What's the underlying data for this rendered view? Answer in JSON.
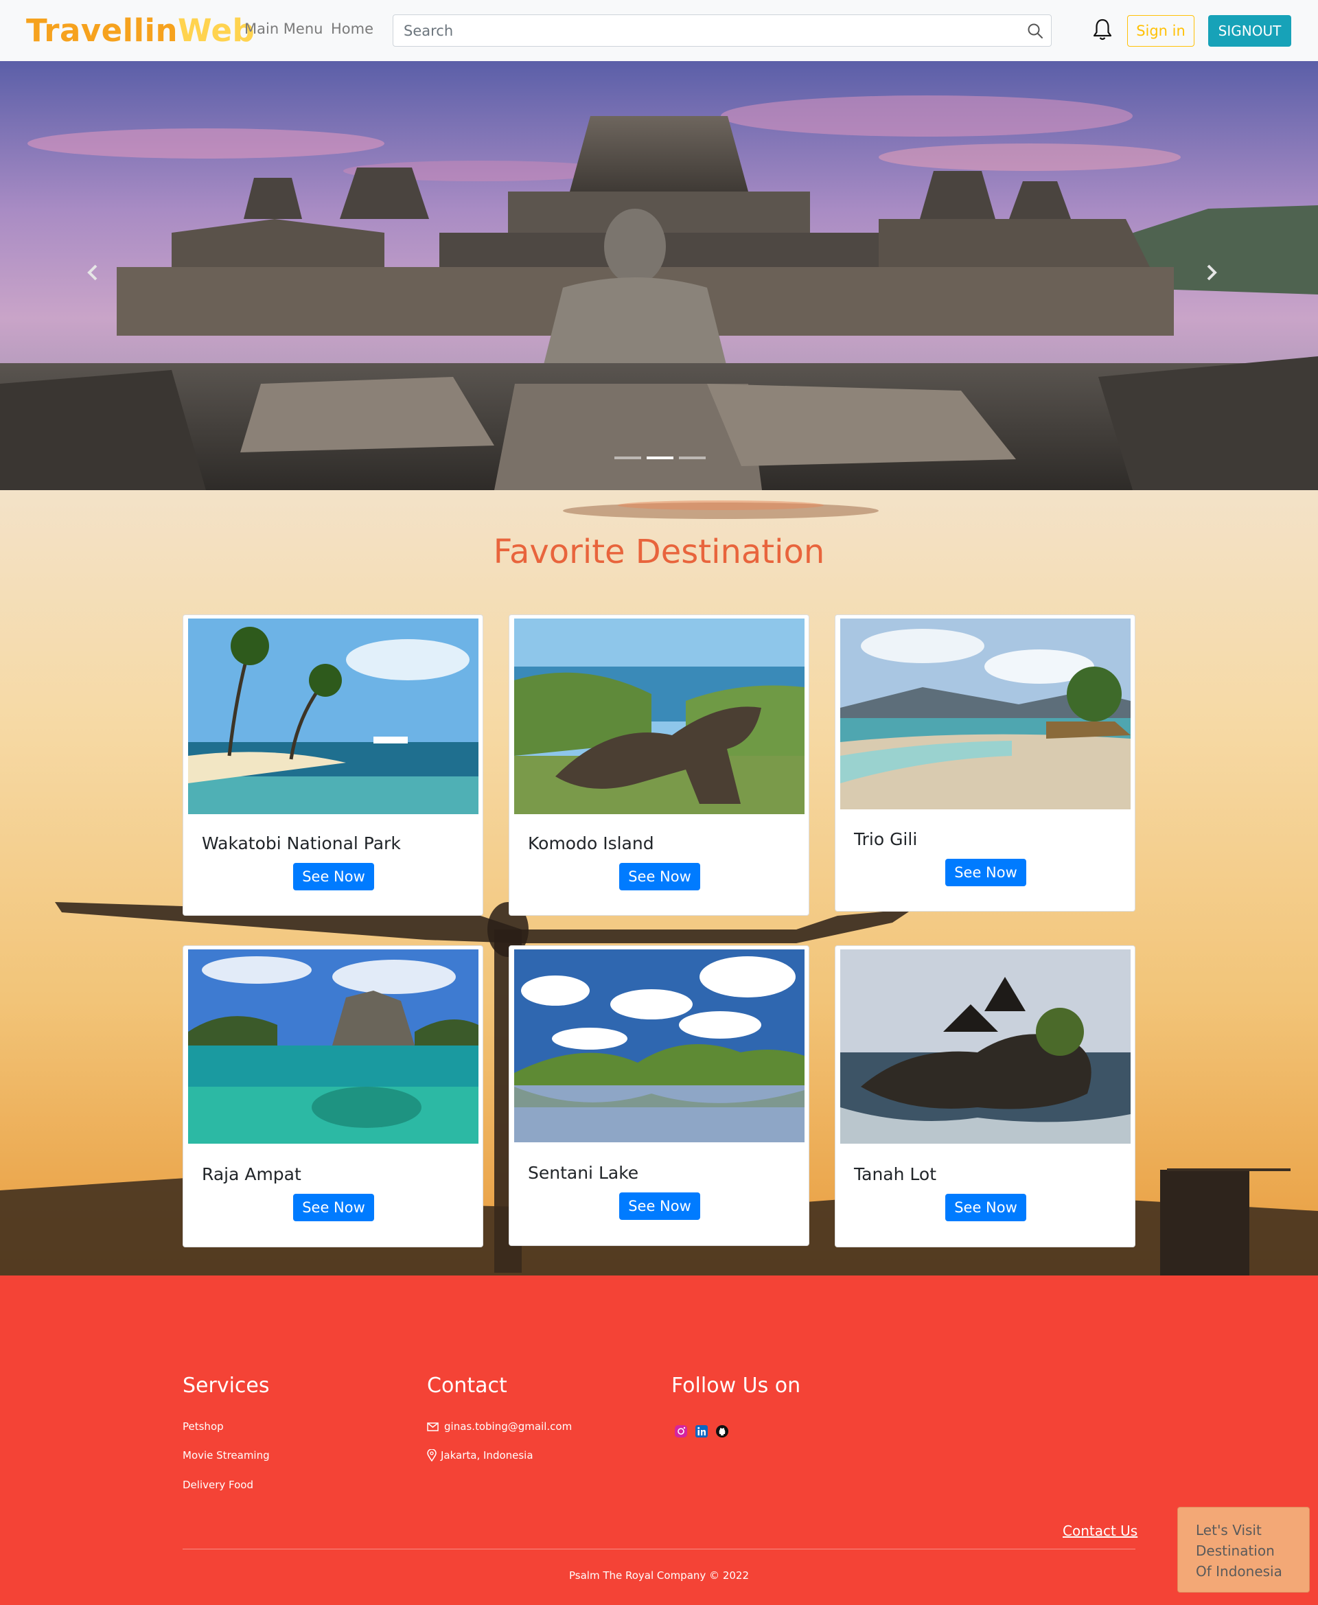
{
  "navbar": {
    "brand_part1": "Travellin",
    "brand_part2": "Web",
    "links": [
      "Main Menu",
      "Home"
    ],
    "search_placeholder": "Search",
    "signin_label": "Sign in",
    "signout_label": "SIGNOUT",
    "icons": [
      "search-icon",
      "bell-icon"
    ]
  },
  "hero": {
    "slides_count": 3,
    "active_slide": 2
  },
  "destinations": {
    "title": "Favorite Destination",
    "button_label": "See Now",
    "cards": [
      {
        "name": "Wakatobi National Park"
      },
      {
        "name": "Komodo Island"
      },
      {
        "name": "Trio Gili"
      },
      {
        "name": "Raja Ampat"
      },
      {
        "name": "Sentani Lake"
      },
      {
        "name": "Tanah Lot"
      }
    ]
  },
  "footer": {
    "services_title": "Services",
    "services": [
      "Petshop",
      "Movie Streaming",
      "Delivery Food"
    ],
    "contact_title": "Contact",
    "email": "ginas.tobing@gmail.com",
    "location": "Jakarta, Indonesia",
    "follow_title": "Follow Us on",
    "social_icons": [
      "instagram-icon",
      "linkedin-icon",
      "github-icon"
    ],
    "contact_us": "Contact Us",
    "copyright": "Psalm The Royal Company © 2022"
  },
  "floating_box": {
    "lines": [
      "Let's Visit",
      "Destination",
      "Of Indonesia"
    ]
  },
  "colors": {
    "brand_orange": "#f6a21e",
    "brand_yellow": "#ffd34f",
    "title_orange": "#e8643c",
    "button_blue": "#007bff",
    "signout_teal": "#17a2b8",
    "signin_yellow": "#ffc107",
    "footer_red": "#f44336",
    "floating_box": "#f3a876"
  }
}
